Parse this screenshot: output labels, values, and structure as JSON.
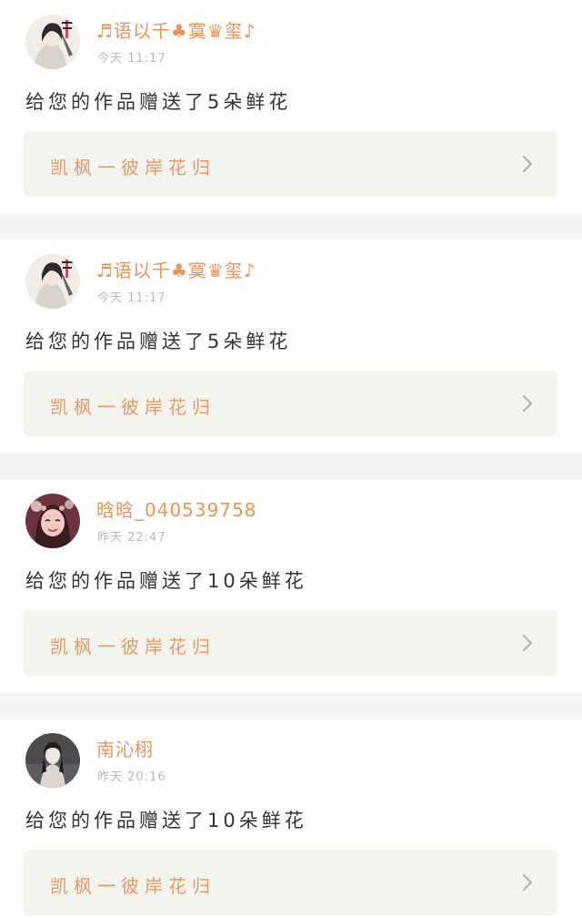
{
  "notifications": [
    {
      "username": "♬语以千♣寞♛玺♪",
      "time": "今天 11:17",
      "message": "给您的作品赠送了5朵鲜花",
      "work_title": "凯枫一彼岸花归",
      "avatar": "anime-ink-illustration",
      "colors": {
        "bg": "#f1ece6",
        "hair": "#2b2a2e",
        "accent": "#c45050",
        "robe": "#d8d2c8"
      }
    },
    {
      "username": "♬语以千♣寞♛玺♪",
      "time": "今天 11:17",
      "message": "给您的作品赠送了5朵鲜花",
      "work_title": "凯枫一彼岸花归",
      "avatar": "anime-ink-illustration",
      "colors": {
        "bg": "#f1ece6",
        "hair": "#2b2a2e",
        "accent": "#c45050",
        "robe": "#d8d2c8"
      }
    },
    {
      "username": "晗晗_040539758",
      "time": "昨天 22:47",
      "message": "给您的作品赠送了10朵鲜花",
      "work_title": "凯枫一彼岸花归",
      "avatar": "girl-portrait",
      "colors": {
        "bg": "#6b3440",
        "hair": "#3a1d1e",
        "accent": "#e7a8a8",
        "robe": "#f2c9be"
      }
    },
    {
      "username": "南沁栩",
      "time": "昨天 20:16",
      "message": "给您的作品赠送了10朵鲜花",
      "work_title": "凯枫一彼岸花归",
      "avatar": "girl-photo-dark",
      "colors": {
        "bg": "#4b4a4d",
        "hair": "#1f1d1f",
        "accent": "#e9e4de",
        "robe": "#dcd6cf"
      }
    }
  ]
}
